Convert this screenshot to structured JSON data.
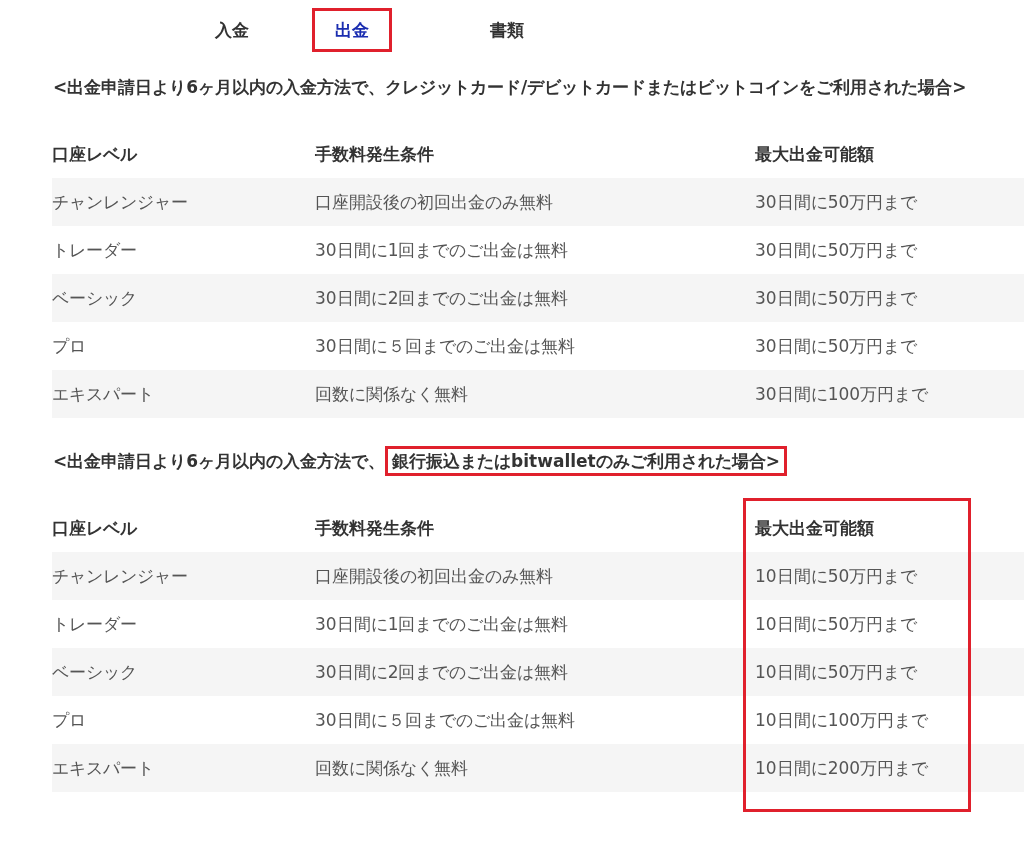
{
  "tabs": [
    {
      "label": "入金",
      "selected": false
    },
    {
      "label": "出金",
      "selected": true
    },
    {
      "label": "書類",
      "selected": false
    }
  ],
  "sections": [
    {
      "heading": [
        {
          "text": "<出金申請日より6ヶ月以内の入金方法で、クレジットカード/デビットカードまたはビットコインをご利用された場合>",
          "highlighted": false
        }
      ],
      "table": {
        "columns": [
          {
            "label": "口座レベル",
            "highlighted": false
          },
          {
            "label": "手数料発生条件",
            "highlighted": false
          },
          {
            "label": "最大出金可能額",
            "highlighted": false
          }
        ],
        "rows": [
          [
            "チャンレンジャー",
            "口座開設後の初回出金のみ無料",
            "30日間に50万円まで"
          ],
          [
            "トレーダー",
            "30日間に1回までのご出金は無料",
            "30日間に50万円まで"
          ],
          [
            "ベーシック",
            "30日間に2回までのご出金は無料",
            "30日間に50万円まで"
          ],
          [
            "プロ",
            "30日間に５回までのご出金は無料",
            "30日間に50万円まで"
          ],
          [
            "エキスパート",
            "回数に関係なく無料",
            "30日間に100万円まで"
          ]
        ]
      }
    },
    {
      "heading": [
        {
          "text": "<出金申請日より6ヶ月以内の入金方法で、",
          "highlighted": false
        },
        {
          "text": "銀行振込またはbitwalletのみご利用された場合>",
          "highlighted": true
        }
      ],
      "table": {
        "columns": [
          {
            "label": "口座レベル",
            "highlighted": false
          },
          {
            "label": "手数料発生条件",
            "highlighted": false
          },
          {
            "label": "最大出金可能額",
            "highlighted": true
          }
        ],
        "rows": [
          [
            "チャンレンジャー",
            "口座開設後の初回出金のみ無料",
            "10日間に50万円まで"
          ],
          [
            "トレーダー",
            "30日間に1回までのご出金は無料",
            "10日間に50万円まで"
          ],
          [
            "ベーシック",
            "30日間に2回までのご出金は無料",
            "10日間に50万円まで"
          ],
          [
            "プロ",
            "30日間に５回までのご出金は無料",
            "10日間に100万円まで"
          ],
          [
            "エキスパート",
            "回数に関係なく無料",
            "10日間に200万円まで"
          ]
        ]
      }
    }
  ]
}
